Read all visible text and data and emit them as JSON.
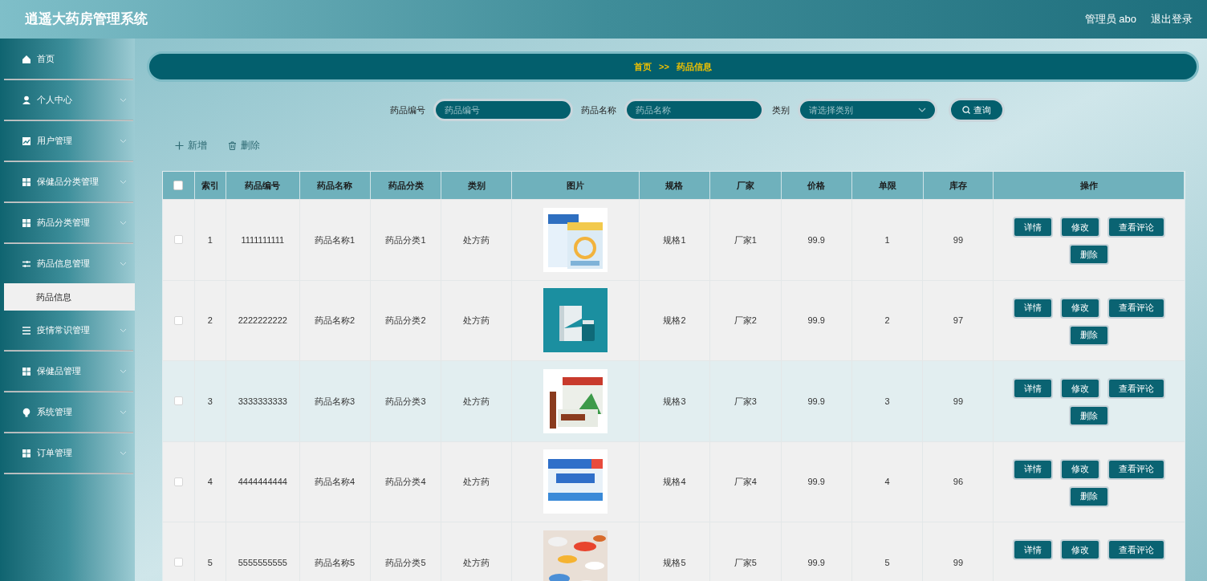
{
  "header": {
    "title": "逍遥大药房管理系统",
    "user": "管理员 abo",
    "logout": "退出登录"
  },
  "sidebar": {
    "items": [
      {
        "label": "首页",
        "expanded": false
      },
      {
        "label": "个人中心",
        "expanded": false
      },
      {
        "label": "用户管理",
        "expanded": false
      },
      {
        "label": "保健品分类管理",
        "expanded": false
      },
      {
        "label": "药品分类管理",
        "expanded": false
      },
      {
        "label": "药品信息管理",
        "expanded": true,
        "children": [
          {
            "label": "药品信息",
            "selected": true
          }
        ]
      },
      {
        "label": "疫情常识管理",
        "expanded": false
      },
      {
        "label": "保健品管理",
        "expanded": false
      },
      {
        "label": "系统管理",
        "expanded": false
      },
      {
        "label": "订单管理",
        "expanded": false
      }
    ]
  },
  "breadcrumb": [
    "首页",
    ">>",
    "药品信息"
  ],
  "search": {
    "fields": [
      {
        "label": "药品编号",
        "placeholder": "药品编号",
        "kind": "input"
      },
      {
        "label": "药品名称",
        "placeholder": "药品名称",
        "kind": "input"
      },
      {
        "label": "类别",
        "placeholder": "请选择类别",
        "kind": "select"
      }
    ],
    "button": "查询"
  },
  "toolbar": [
    "新增",
    "删除"
  ],
  "table": {
    "select_all": false,
    "columns": [
      "索引",
      "药品编号",
      "药品名称",
      "药品分类",
      "类别",
      "图片",
      "规格",
      "厂家",
      "价格",
      "单限",
      "库存",
      "操作"
    ],
    "rows": [
      {
        "checked": false,
        "highlighted": false,
        "cells": [
          "1",
          "1111111111",
          "药品名称1",
          "药品分类1",
          "处方药"
        ],
        "picture": {
          "kind": "picture"
        },
        "cells2": [
          "规格1",
          "厂家1",
          "99.9",
          "1",
          "99"
        ],
        "actions": [
          "详情",
          "修改",
          "查看评论",
          "删除"
        ]
      },
      {
        "checked": false,
        "highlighted": false,
        "cells": [
          "2",
          "2222222222",
          "药品名称2",
          "药品分类2",
          "处方药"
        ],
        "picture": {
          "kind": "picture"
        },
        "cells2": [
          "规格2",
          "厂家2",
          "99.9",
          "2",
          "97"
        ],
        "actions": [
          "详情",
          "修改",
          "查看评论",
          "删除"
        ]
      },
      {
        "checked": false,
        "highlighted": true,
        "cells": [
          "3",
          "3333333333",
          "药品名称3",
          "药品分类3",
          "处方药"
        ],
        "picture": {
          "kind": "picture"
        },
        "cells2": [
          "规格3",
          "厂家3",
          "99.9",
          "3",
          "99"
        ],
        "actions": [
          "详情",
          "修改",
          "查看评论",
          "删除"
        ]
      },
      {
        "checked": false,
        "highlighted": false,
        "cells": [
          "4",
          "4444444444",
          "药品名称4",
          "药品分类4",
          "处方药"
        ],
        "picture": {
          "kind": "picture"
        },
        "cells2": [
          "规格4",
          "厂家4",
          "99.9",
          "4",
          "96"
        ],
        "actions": [
          "详情",
          "修改",
          "查看评论",
          "删除"
        ]
      },
      {
        "checked": false,
        "highlighted": false,
        "cells": [
          "5",
          "5555555555",
          "药品名称5",
          "药品分类5",
          "处方药"
        ],
        "picture": {
          "kind": "picture"
        },
        "cells2": [
          "规格5",
          "厂家5",
          "99.9",
          "5",
          "99"
        ],
        "actions": [
          "详情",
          "修改",
          "查看评论"
        ]
      }
    ]
  }
}
